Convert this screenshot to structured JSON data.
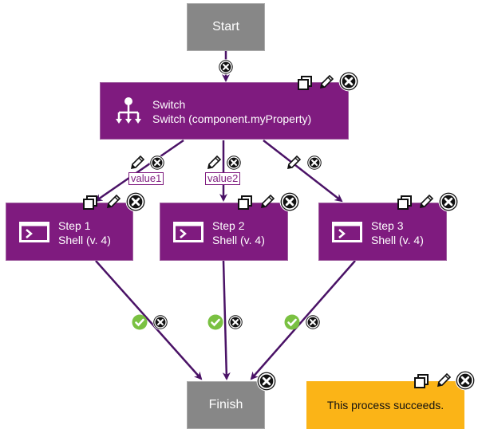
{
  "nodes": {
    "start": {
      "label": "Start"
    },
    "switch": {
      "title": "Switch",
      "subtitle": "Switch (component.myProperty)"
    },
    "step1": {
      "title": "Step 1",
      "subtitle": "Shell (v. 4)"
    },
    "step2": {
      "title": "Step 2",
      "subtitle": "Shell (v. 4)"
    },
    "step3": {
      "title": "Step 3",
      "subtitle": "Shell (v. 4)"
    },
    "finish": {
      "label": "Finish"
    }
  },
  "edge_labels": {
    "e1": "value1",
    "e2": "value2"
  },
  "note": {
    "text": "This process succeeds."
  },
  "colors": {
    "process": "#7f1b7f",
    "edge": "#4a1266",
    "terminal": "#878787",
    "note": "#fbb417",
    "success": "#7ac142"
  }
}
